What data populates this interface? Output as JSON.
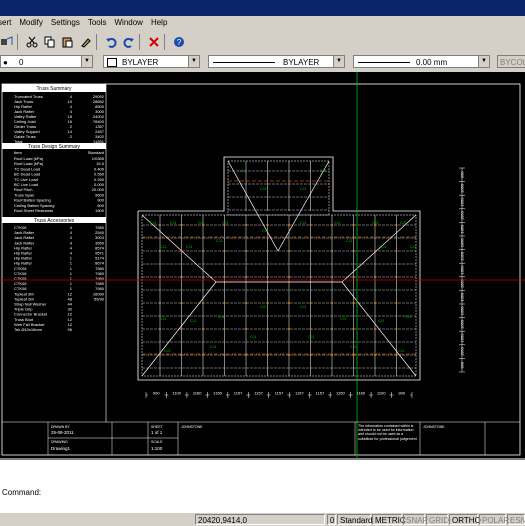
{
  "menu": [
    "sert",
    "Modify",
    "Settings",
    "Tools",
    "Window",
    "Help"
  ],
  "toolbar": {
    "layer_value": "0",
    "color_value": "BYLAYER",
    "linetype_value": "BYLAYER",
    "lineweight_value": "0.00 mm",
    "plotstyle_value": "BYCOLOR"
  },
  "panel_titles": {
    "summary": "Truss Summary",
    "design": "Truss Design Summary",
    "accessories": "Truss Accessories"
  },
  "summary_rows": [
    {
      "label": "Truncated Truss",
      "qty": "4",
      "val": "29092"
    },
    {
      "label": "Jack Truss",
      "qty": "10",
      "val": "28652"
    },
    {
      "label": "Hip Rafter",
      "qty": "4",
      "val": "8500"
    },
    {
      "label": "Jack Rafter",
      "qty": "4",
      "val": "3000"
    },
    {
      "label": "Valley Rafter",
      "qty": "18",
      "val": "24002"
    },
    {
      "label": "Ceiling Joist",
      "qty": "16",
      "val": "78400"
    },
    {
      "label": "Girder Truss",
      "qty": "2",
      "val": "1357"
    },
    {
      "label": "Valley Support",
      "qty": "14",
      "val": "2457"
    },
    {
      "label": "Gable Truss",
      "qty": "2",
      "val": "3402"
    },
    {
      "label": "Total",
      "qty": "",
      "val": "11591"
    }
  ],
  "design_header": [
    "Item",
    "Standard"
  ],
  "design_rows": [
    {
      "label": "Roof Load (kPa)",
      "val": "1/0365"
    },
    {
      "label": "Roof Load (kPa)",
      "val": "15.0"
    },
    {
      "label": "TC Dead Load",
      "val": "0.400"
    },
    {
      "label": "BC Dead Load",
      "val": "0.550"
    },
    {
      "label": "TC Live Load",
      "val": "0.250"
    },
    {
      "label": "BC Live Load",
      "val": "0.000"
    },
    {
      "label": "Roof Pitch",
      "val": "20.000"
    },
    {
      "label": "Truss Span",
      "val": "9600"
    },
    {
      "label": "Roof Batten Spacing",
      "val": "900"
    },
    {
      "label": "Ceiling Batten Spacing",
      "val": "600"
    },
    {
      "label": "Roof Sheet Restraints",
      "val": "1800"
    }
  ],
  "accessory_rows": [
    {
      "label": "CTK08",
      "qty": "4",
      "val": "7980"
    },
    {
      "label": "Jack Rafter",
      "qty": "4",
      "val": "2540"
    },
    {
      "label": "Jack Rafter",
      "qty": "4",
      "val": "3004"
    },
    {
      "label": "Jack Rafter",
      "qty": "4",
      "val": "3550"
    },
    {
      "label": "Hip Rafter",
      "qty": "4",
      "val": "8574"
    },
    {
      "label": "Hip Rafter",
      "qty": "4",
      "val": "9571"
    },
    {
      "label": "Hip Rafter",
      "qty": "1",
      "val": "5174"
    },
    {
      "label": "Hip Rafter",
      "qty": "1",
      "val": "8674"
    },
    {
      "label": "CTK08",
      "qty": "1",
      "val": "7980"
    },
    {
      "label": "CTK08",
      "qty": "1",
      "val": "7980"
    },
    {
      "label": "CTK08",
      "qty": "1",
      "val": "7980"
    },
    {
      "label": "CTK08",
      "qty": "1",
      "val": "7980"
    },
    {
      "label": "CTK08",
      "qty": "1",
      "val": "7980"
    },
    {
      "label": "Topleaf 3M",
      "qty": "12",
      "val": "16090"
    },
    {
      "label": "Topleaf 2M",
      "qty": "48",
      "val": "55/90"
    },
    {
      "label": "Strap Nail Washer",
      "qty": "44",
      "val": ""
    },
    {
      "label": "Triple Grip",
      "qty": "30",
      "val": ""
    },
    {
      "label": "Connector Bracket",
      "qty": "12",
      "val": ""
    },
    {
      "label": "Truss Boot",
      "qty": "12",
      "val": ""
    },
    {
      "label": "Web Fall Bracket",
      "qty": "12",
      "val": ""
    },
    {
      "label": "Tek Ø10x16mm",
      "qty": "96",
      "val": ""
    }
  ],
  "dims_bottom": [
    "900",
    "1100",
    "1160",
    "1150",
    "1157",
    "1157",
    "1157",
    "1157",
    "1157",
    "1150",
    "1160",
    "1100",
    "900"
  ],
  "dims_right": [
    "900",
    "1050",
    "1050",
    "1050",
    "1050",
    "1050",
    "1050",
    "1050",
    "1050",
    "1050",
    "1050",
    "1050",
    "1050",
    "1050",
    "900"
  ],
  "title_block": {
    "date_label": "DRAWN BY",
    "date_value": "25-08-2011",
    "drawing_label": "DRAWING",
    "drawing_value": "Drawing1",
    "sheet_label": "SHEET",
    "sheet_value": "1 of 1",
    "scale_label": "SCALE",
    "scale_value": "1:100",
    "note": "The information contained within is intended to be used for information and should not be used as a substitute for professional judgement",
    "brand": "JOHNSTONE"
  },
  "truss_label": "CJ1",
  "command": {
    "line1": "",
    "line2": "",
    "prompt": "Command:"
  },
  "status": {
    "coords": "20420,9414,0",
    "zero": "0",
    "standard": "Standard",
    "metric": "METRIC",
    "buttons": [
      {
        "label": "SNAP",
        "on": false
      },
      {
        "label": "GRID",
        "on": false
      },
      {
        "label": "ORTHO",
        "on": true
      },
      {
        "label": "POLAR",
        "on": false
      },
      {
        "label": "ESNA",
        "on": false
      }
    ]
  },
  "colors": {
    "canvas": "#000000",
    "line": "#ffffff",
    "green": "#00c000",
    "orange": "#ff8000",
    "red": "#c00000",
    "panel_head": "#ffffff"
  }
}
